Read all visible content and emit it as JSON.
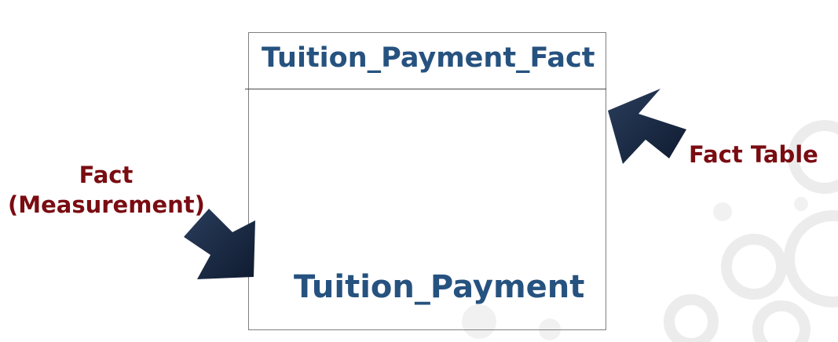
{
  "diagram": {
    "entity": {
      "name": "Tuition_Payment_Fact",
      "attribute": "Tuition_Payment"
    },
    "annotations": {
      "fact_line1": "Fact",
      "fact_line2": "(Measurement)",
      "fact_table": "Fact Table"
    },
    "colors": {
      "entity_text": "#26527f",
      "annotation_text": "#7a0c12",
      "arrow_fill": "#1b2a44"
    }
  }
}
